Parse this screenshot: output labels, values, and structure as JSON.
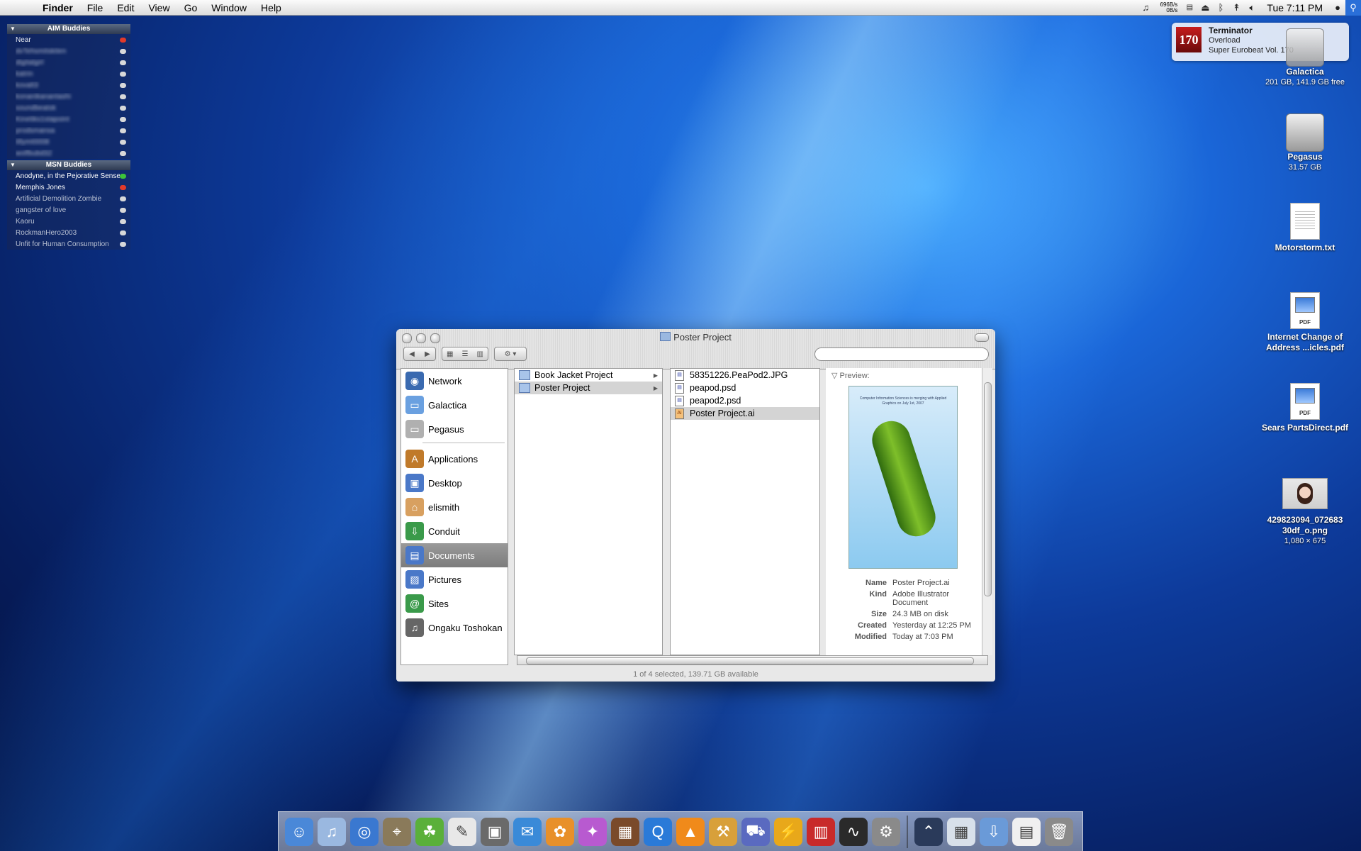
{
  "menubar": {
    "app": "Finder",
    "menus": [
      "File",
      "Edit",
      "View",
      "Go",
      "Window",
      "Help"
    ],
    "net_up": "696B/s",
    "net_down": "0B/s",
    "clock": "Tue 7:11 PM"
  },
  "buddies": {
    "aim_title": "AIM Buddies",
    "aim": [
      {
        "name": "Near",
        "status": "red",
        "blur": false
      },
      {
        "name": "dvTehsmitskiten",
        "status": "grey",
        "blur": true
      },
      {
        "name": "digitalgirl",
        "status": "grey",
        "blur": true
      },
      {
        "name": "katrin",
        "status": "grey",
        "blur": true
      },
      {
        "name": "kovalt3",
        "status": "grey",
        "blur": true
      },
      {
        "name": "konanikanantashi",
        "status": "grey",
        "blur": true
      },
      {
        "name": "soundbeatsk",
        "status": "grey",
        "blur": true
      },
      {
        "name": "Kinetiks1stapoint",
        "status": "grey",
        "blur": true
      },
      {
        "name": "prodsmansa",
        "status": "grey",
        "blur": true
      },
      {
        "name": "lillymt0008",
        "status": "grey",
        "blur": true
      },
      {
        "name": "wolfbubd32",
        "status": "grey",
        "blur": true
      }
    ],
    "msn_title": "MSN Buddies",
    "msn": [
      {
        "name": "Anodyne, in the Pejorative Sense",
        "status": "green",
        "style": "white"
      },
      {
        "name": "Memphis Jones",
        "status": "red",
        "style": "white"
      },
      {
        "name": "Artificial Demolition Zombie",
        "status": "grey",
        "style": "dim"
      },
      {
        "name": "gangster of love",
        "status": "grey",
        "style": "dim"
      },
      {
        "name": "Kaoru",
        "status": "grey",
        "style": "dim"
      },
      {
        "name": "RockmanHero2003",
        "status": "grey",
        "style": "dim"
      },
      {
        "name": "Unfit for Human Consumption",
        "status": "grey",
        "style": "dim"
      }
    ]
  },
  "growl": {
    "art": "170",
    "title": "Terminator",
    "artist": "Overload",
    "album": "Super Eurobeat Vol. 170"
  },
  "desktop": [
    {
      "name": "Galactica",
      "sub": "201 GB, 141.9 GB free"
    },
    {
      "name": "Pegasus",
      "sub": "31.57 GB"
    },
    {
      "name": "Motorstorm.txt",
      "sub": ""
    },
    {
      "name": "Internet Change of Address ...icles.pdf",
      "sub": ""
    },
    {
      "name": "Sears PartsDirect.pdf",
      "sub": ""
    },
    {
      "name": "429823094_07268330df_o.png",
      "sub": "1,080 × 675"
    }
  ],
  "finder": {
    "title": "Poster Project",
    "sidebar": [
      "Network",
      "Galactica",
      "Pegasus",
      "Applications",
      "Desktop",
      "elismith",
      "Conduit",
      "Documents",
      "Pictures",
      "Sites",
      "Ongaku Toshokan"
    ],
    "selected_sidebar": "Documents",
    "col1": [
      "Book Jacket Project",
      "Poster Project"
    ],
    "col2": [
      "58351226.PeaPod2.JPG",
      "peapod.psd",
      "peapod2.psd",
      "Poster Project.ai"
    ],
    "preview_label": "Preview:",
    "preview_caption": "Computer Information Sciences is merging with Applied Graphics on July 1st, 2007",
    "meta": [
      {
        "k": "Name",
        "v": "Poster Project.ai"
      },
      {
        "k": "Kind",
        "v": "Adobe Illustrator Document"
      },
      {
        "k": "Size",
        "v": "24.3 MB on disk"
      },
      {
        "k": "Created",
        "v": "Yesterday at 12:25 PM"
      },
      {
        "k": "Modified",
        "v": "Today at 7:03 PM"
      }
    ],
    "status": "1 of 4 selected, 139.71 GB available"
  },
  "dock": [
    "finder-icon",
    "itunes-icon",
    "safari-icon",
    "preview-icon",
    "adium-icon",
    "textedit-icon",
    "iphoto-icon",
    "mail-icon",
    "flower-icon",
    "butterfly-icon",
    "photo-booth-icon",
    "quicktime-icon",
    "vlc-icon",
    "toolbox-icon",
    "truck-icon",
    "coda-icon",
    "toaster-icon",
    "activity-monitor-icon",
    "system-preferences-icon",
    "applications-stack-icon",
    "calendar-icon",
    "downloads-folder-icon",
    "document-icon",
    "trash-icon"
  ]
}
